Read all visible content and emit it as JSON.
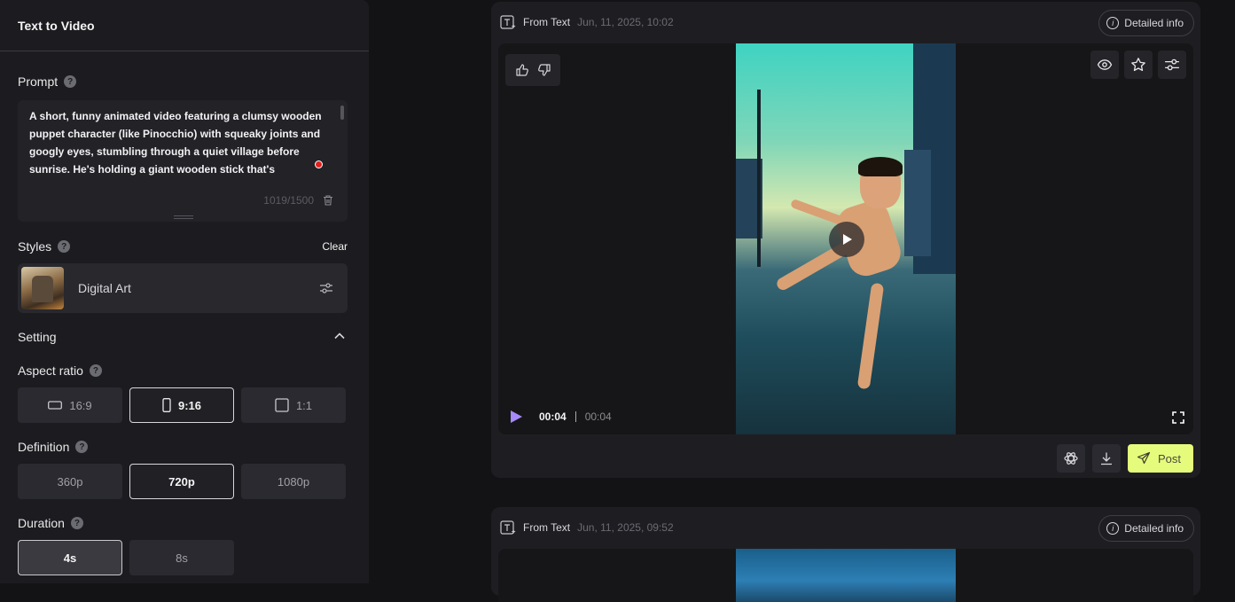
{
  "sidebar": {
    "title": "Text to Video",
    "prompt": {
      "label": "Prompt",
      "text": "A short, funny animated video featuring a clumsy wooden puppet character (like Pinocchio) with squeaky joints and googly eyes, stumbling through a quiet village before sunrise. He's holding a giant wooden stick that's",
      "char_count": "1019/1500"
    },
    "styles": {
      "label": "Styles",
      "clear": "Clear",
      "selected": "Digital Art"
    },
    "setting": {
      "label": "Setting"
    },
    "aspect_ratio": {
      "label": "Aspect ratio",
      "options": [
        "16:9",
        "9:16",
        "1:1"
      ],
      "selected": "9:16"
    },
    "definition": {
      "label": "Definition",
      "options": [
        "360p",
        "720p",
        "1080p"
      ],
      "selected": "720p"
    },
    "duration": {
      "label": "Duration",
      "options": [
        "4s",
        "8s"
      ],
      "selected": "4s"
    },
    "help_glyph": "?"
  },
  "cards": [
    {
      "source": "From Text",
      "date": "Jun, 11, 2025, 10:02",
      "info_label": "Detailed info",
      "current_time": "00:04",
      "total_time": "00:04",
      "post_label": "Post"
    },
    {
      "source": "From Text",
      "date": "Jun, 11, 2025, 09:52",
      "info_label": "Detailed info"
    }
  ],
  "colors": {
    "accent_post": "#e5fb7c",
    "play_purple": "#a78bfa",
    "sidebar_bg": "#1c1c20",
    "page_bg": "#131316"
  },
  "info_glyph": "i"
}
